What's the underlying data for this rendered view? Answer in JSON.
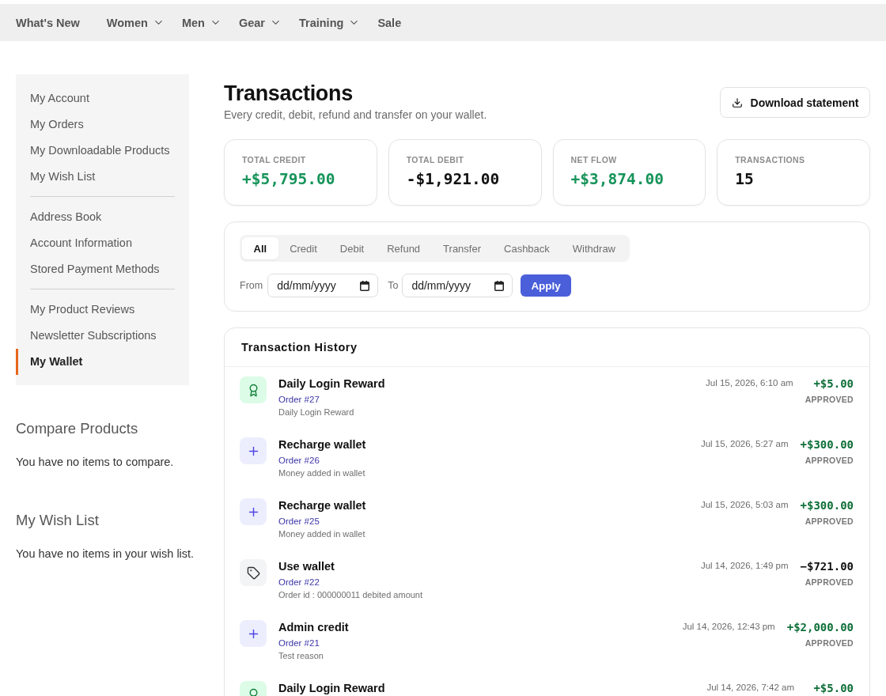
{
  "nav": {
    "items": [
      {
        "label": "What's New",
        "has_menu": false
      },
      {
        "label": "Women",
        "has_menu": true
      },
      {
        "label": "Men",
        "has_menu": true
      },
      {
        "label": "Gear",
        "has_menu": true
      },
      {
        "label": "Training",
        "has_menu": true
      },
      {
        "label": "Sale",
        "has_menu": false
      }
    ]
  },
  "sidebar": {
    "sections": [
      {
        "items": [
          {
            "label": "My Account",
            "selected": false
          },
          {
            "label": "My Orders",
            "selected": false
          },
          {
            "label": "My Downloadable Products",
            "selected": false
          },
          {
            "label": "My Wish List",
            "selected": false
          }
        ]
      },
      {
        "items": [
          {
            "label": "Address Book",
            "selected": false
          },
          {
            "label": "Account Information",
            "selected": false
          },
          {
            "label": "Stored Payment Methods",
            "selected": false
          }
        ]
      },
      {
        "items": [
          {
            "label": "My Product Reviews",
            "selected": false
          },
          {
            "label": "Newsletter Subscriptions",
            "selected": false
          },
          {
            "label": "My Wallet",
            "selected": true
          }
        ]
      }
    ]
  },
  "blocks": [
    {
      "title": "Compare Products",
      "text": "You have no items to compare."
    },
    {
      "title": "My Wish List",
      "text": "You have no items in your wish list."
    }
  ],
  "header": {
    "title": "Transactions",
    "subtitle": "Every credit, debit, refund and transfer on your wallet.",
    "button": "Download statement"
  },
  "stats": [
    {
      "label": "TOTAL CREDIT",
      "value": "+$5,795.00",
      "color": "#17945a"
    },
    {
      "label": "TOTAL DEBIT",
      "value": "-$1,921.00",
      "color": "#111111"
    },
    {
      "label": "NET FLOW",
      "value": "+$3,874.00",
      "color": "#17945a"
    },
    {
      "label": "TRANSACTIONS",
      "value": "15",
      "color": "#111111"
    }
  ],
  "filters": {
    "tabs": [
      {
        "label": "All",
        "selected": true
      },
      {
        "label": "Credit",
        "selected": false
      },
      {
        "label": "Debit",
        "selected": false
      },
      {
        "label": "Refund",
        "selected": false
      },
      {
        "label": "Transfer",
        "selected": false
      },
      {
        "label": "Cashback",
        "selected": false
      },
      {
        "label": "Withdraw",
        "selected": false
      }
    ],
    "from": {
      "label": "From",
      "placeholder": "dd/mm/yyyy"
    },
    "to": {
      "label": "To",
      "placeholder": "dd/mm/yyyy"
    },
    "apply": "Apply"
  },
  "history": {
    "title": "Transaction History",
    "rows": [
      {
        "kind": "reward",
        "title": "Daily Login Reward",
        "order": "Order #27",
        "note": "Daily Login Reward",
        "date": "Jul 15, 2026, 6:10 am",
        "amount": "+$5.00",
        "color": "#0e6f38",
        "status": "APPROVED"
      },
      {
        "kind": "credit",
        "title": "Recharge wallet",
        "order": "Order #26",
        "note": "Money added in wallet",
        "date": "Jul 15, 2026, 5:27 am",
        "amount": "+$300.00",
        "color": "#0e6f38",
        "status": "APPROVED"
      },
      {
        "kind": "credit",
        "title": "Recharge wallet",
        "order": "Order #25",
        "note": "Money added in wallet",
        "date": "Jul 15, 2026, 5:03 am",
        "amount": "+$300.00",
        "color": "#0e6f38",
        "status": "APPROVED"
      },
      {
        "kind": "debit",
        "title": "Use wallet",
        "order": "Order #22",
        "note": "Order id : 000000011 debited amount",
        "date": "Jul 14, 2026, 1:49 pm",
        "amount": "−$721.00",
        "color": "#111111",
        "status": "APPROVED"
      },
      {
        "kind": "credit",
        "title": "Admin credit",
        "order": "Order #21",
        "note": "Test reason",
        "date": "Jul 14, 2026, 12:43 pm",
        "amount": "+$2,000.00",
        "color": "#0e6f38",
        "status": "APPROVED"
      },
      {
        "kind": "reward",
        "title": "Daily Login Reward",
        "date": "Jul 14, 2026, 7:42 am",
        "amount": "+$5.00",
        "color": "#0e6f38"
      }
    ]
  }
}
